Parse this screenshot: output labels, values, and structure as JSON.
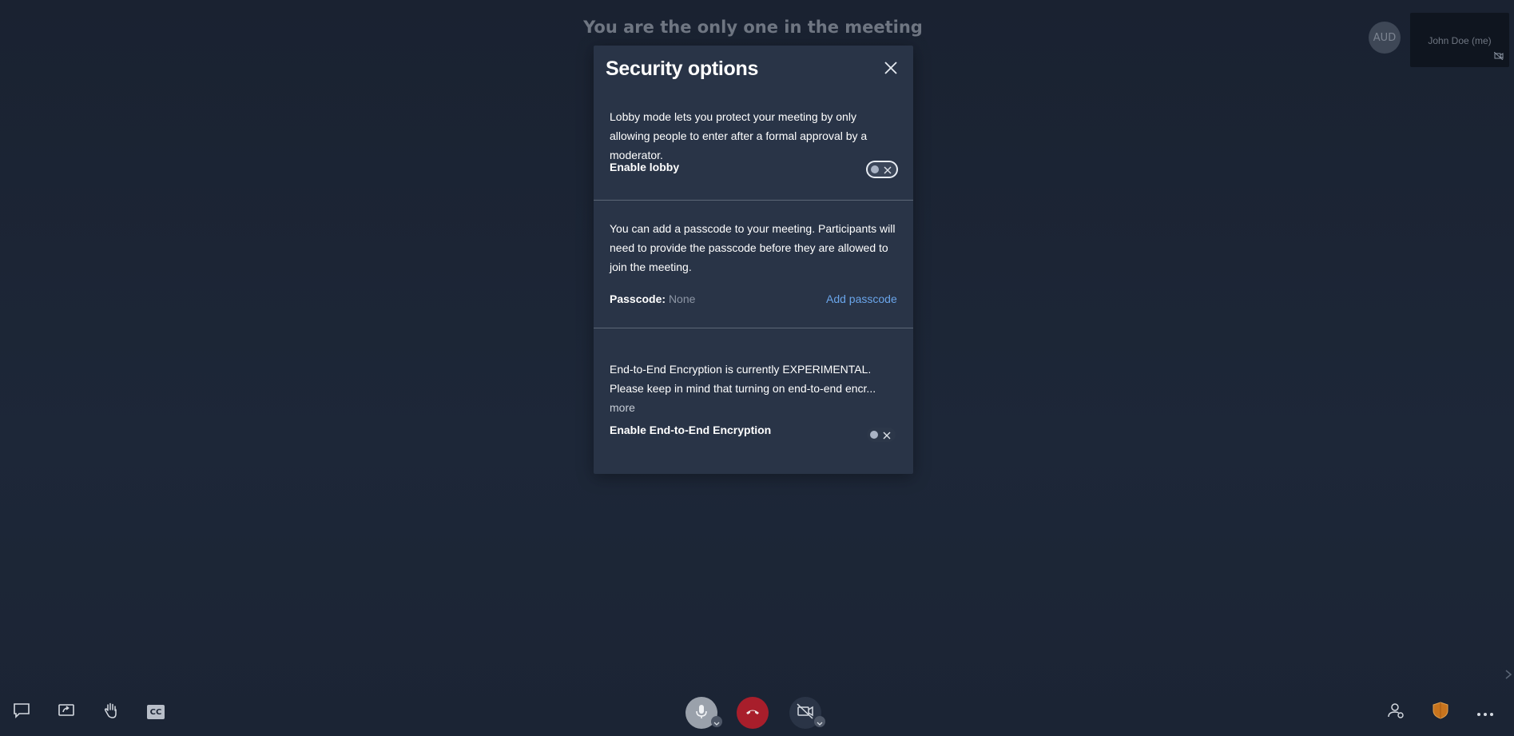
{
  "meeting": {
    "status_text": "You are the only one in the meeting"
  },
  "filmstrip": {
    "avatar_initials": "AUD",
    "local_name": "John Doe (me)"
  },
  "modal": {
    "title": "Security options",
    "lobby": {
      "description": "Lobby mode lets you protect your meeting by only allowing people to enter after a formal approval by a moderator.",
      "label": "Enable lobby",
      "enabled": false
    },
    "passcode": {
      "description": "You can add a passcode to your meeting. Participants will need to provide the passcode before they are allowed to join the meeting.",
      "label": "Passcode:",
      "value": "None",
      "add_link": "Add passcode"
    },
    "e2ee": {
      "description": "End-to-End Encryption is currently EXPERIMENTAL. Please keep in mind that turning on end-to-end encr...",
      "more_link": "more",
      "label": "Enable End-to-End Encryption",
      "enabled": false
    }
  },
  "toolbar": {
    "left_icons": [
      "chat-icon",
      "screenshare-icon",
      "raise-hand-icon",
      "closed-captions-icon"
    ],
    "cc_text": "CC",
    "center_icons": [
      "microphone-icon",
      "hangup-icon",
      "camera-off-icon"
    ],
    "right_icons": [
      "participants-icon",
      "security-shield-icon",
      "more-dots-icon"
    ]
  },
  "colors": {
    "accent_link": "#6aa5ea",
    "hangup_red": "#a81e2b",
    "shield_orange": "#c8741d",
    "modal_bg": "#293447"
  }
}
